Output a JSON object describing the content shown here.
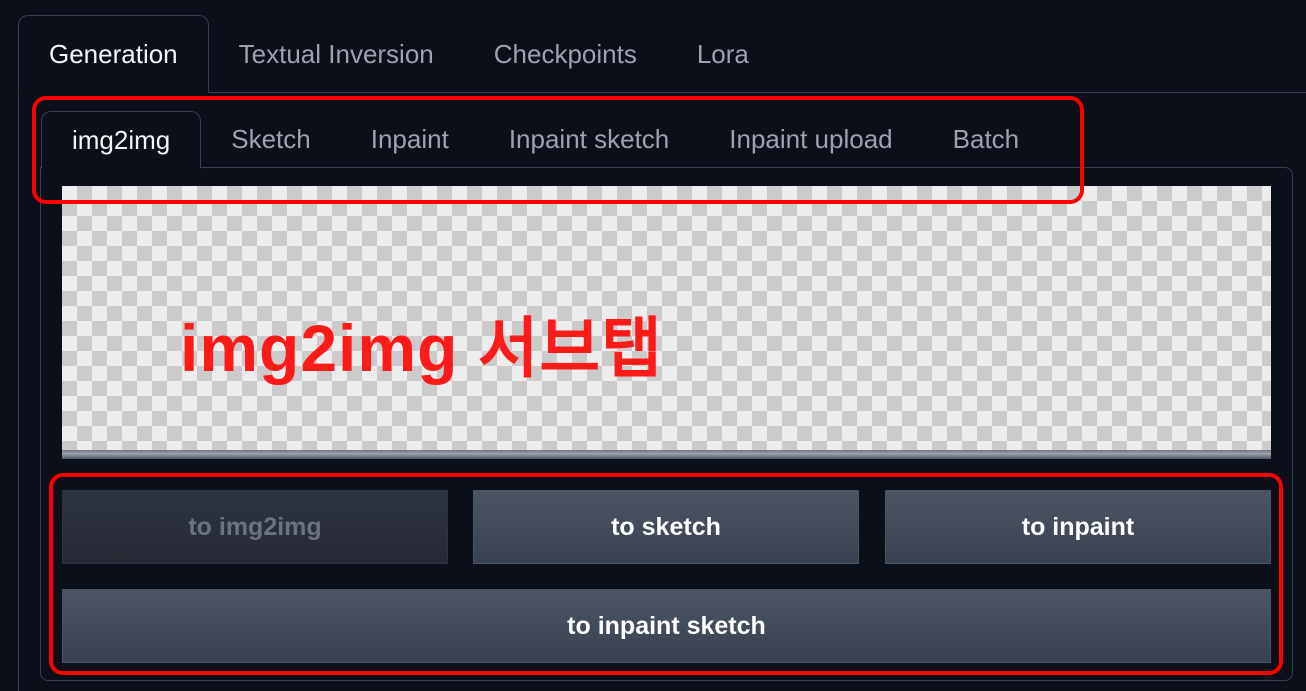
{
  "top_tabs": [
    {
      "label": "Generation",
      "active": true
    },
    {
      "label": "Textual Inversion",
      "active": false
    },
    {
      "label": "Checkpoints",
      "active": false
    },
    {
      "label": "Lora",
      "active": false
    }
  ],
  "sub_tabs": [
    {
      "label": "img2img",
      "active": true
    },
    {
      "label": "Sketch",
      "active": false
    },
    {
      "label": "Inpaint",
      "active": false
    },
    {
      "label": "Inpaint sketch",
      "active": false
    },
    {
      "label": "Inpaint upload",
      "active": false
    },
    {
      "label": "Batch",
      "active": false
    }
  ],
  "annotation": {
    "text": "img2img 서브탭",
    "color": "#ff1a1a"
  },
  "buttons": {
    "to_img2img": {
      "label": "to img2img",
      "disabled": true
    },
    "to_sketch": {
      "label": "to sketch",
      "disabled": false
    },
    "to_inpaint": {
      "label": "to inpaint",
      "disabled": false
    },
    "to_inpaint_sketch": {
      "label": "to inpaint sketch",
      "disabled": false
    }
  },
  "colors": {
    "background": "#0b0f19",
    "highlight": "#ff0000",
    "tab_active_text": "#f3f4f6",
    "tab_inactive_text": "#9ca3af",
    "button_bg": "#4b5563"
  }
}
